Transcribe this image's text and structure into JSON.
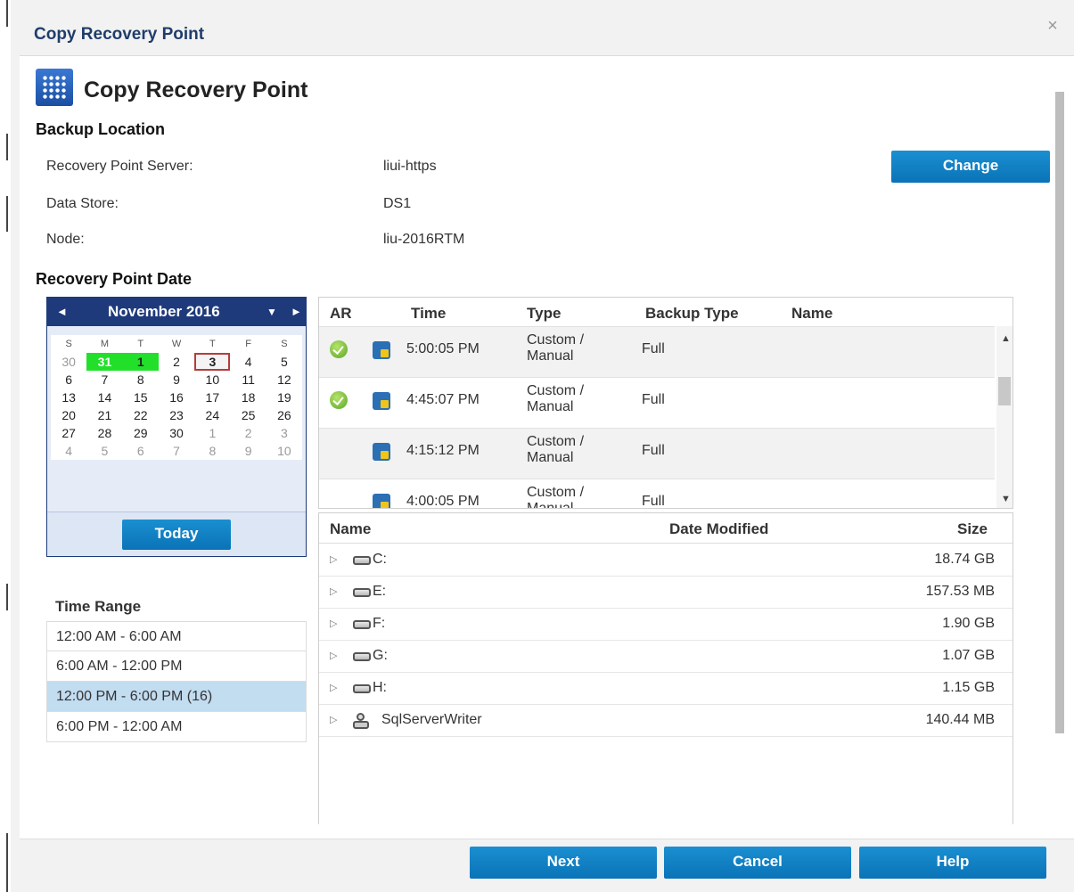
{
  "window": {
    "title": "Copy Recovery Point",
    "close_icon": "×"
  },
  "header": {
    "icon": "grid-app-icon",
    "title": "Copy Recovery Point"
  },
  "backup_location": {
    "section_title": "Backup Location",
    "server_label": "Recovery Point Server:",
    "server_value": "liui-https",
    "store_label": "Data Store:",
    "store_value": "DS1",
    "node_label": "Node:",
    "node_value": "liu-2016RTM",
    "change_button": "Change"
  },
  "recovery_point_date": {
    "section_title": "Recovery Point Date"
  },
  "calendar": {
    "month": "November 2016",
    "prev_icon": "◄",
    "dropdown_icon": "▼",
    "next_icon": "►",
    "weekdays": [
      "S",
      "M",
      "T",
      "W",
      "T",
      "F",
      "S"
    ],
    "today_button": "Today",
    "days": [
      {
        "label": "30",
        "other": true,
        "hl": false,
        "today": false
      },
      {
        "label": "31",
        "other": true,
        "hl": true,
        "today": false
      },
      {
        "label": "1",
        "other": false,
        "hl": true,
        "today": false
      },
      {
        "label": "2",
        "other": false,
        "hl": false,
        "today": false
      },
      {
        "label": "3",
        "other": false,
        "hl": false,
        "today": true
      },
      {
        "label": "4",
        "other": false,
        "hl": false,
        "today": false
      },
      {
        "label": "5",
        "other": false,
        "hl": false,
        "today": false
      },
      {
        "label": "6",
        "other": false,
        "hl": false,
        "today": false
      },
      {
        "label": "7",
        "other": false,
        "hl": false,
        "today": false
      },
      {
        "label": "8",
        "other": false,
        "hl": false,
        "today": false
      },
      {
        "label": "9",
        "other": false,
        "hl": false,
        "today": false
      },
      {
        "label": "10",
        "other": false,
        "hl": false,
        "today": false
      },
      {
        "label": "11",
        "other": false,
        "hl": false,
        "today": false
      },
      {
        "label": "12",
        "other": false,
        "hl": false,
        "today": false
      },
      {
        "label": "13",
        "other": false,
        "hl": false,
        "today": false
      },
      {
        "label": "14",
        "other": false,
        "hl": false,
        "today": false
      },
      {
        "label": "15",
        "other": false,
        "hl": false,
        "today": false
      },
      {
        "label": "16",
        "other": false,
        "hl": false,
        "today": false
      },
      {
        "label": "17",
        "other": false,
        "hl": false,
        "today": false
      },
      {
        "label": "18",
        "other": false,
        "hl": false,
        "today": false
      },
      {
        "label": "19",
        "other": false,
        "hl": false,
        "today": false
      },
      {
        "label": "20",
        "other": false,
        "hl": false,
        "today": false
      },
      {
        "label": "21",
        "other": false,
        "hl": false,
        "today": false
      },
      {
        "label": "22",
        "other": false,
        "hl": false,
        "today": false
      },
      {
        "label": "23",
        "other": false,
        "hl": false,
        "today": false
      },
      {
        "label": "24",
        "other": false,
        "hl": false,
        "today": false
      },
      {
        "label": "25",
        "other": false,
        "hl": false,
        "today": false
      },
      {
        "label": "26",
        "other": false,
        "hl": false,
        "today": false
      },
      {
        "label": "27",
        "other": false,
        "hl": false,
        "today": false
      },
      {
        "label": "28",
        "other": false,
        "hl": false,
        "today": false
      },
      {
        "label": "29",
        "other": false,
        "hl": false,
        "today": false
      },
      {
        "label": "30",
        "other": false,
        "hl": false,
        "today": false
      },
      {
        "label": "1",
        "other": true,
        "hl": false,
        "today": false
      },
      {
        "label": "2",
        "other": true,
        "hl": false,
        "today": false
      },
      {
        "label": "3",
        "other": true,
        "hl": false,
        "today": false
      },
      {
        "label": "4",
        "other": true,
        "hl": false,
        "today": false
      },
      {
        "label": "5",
        "other": true,
        "hl": false,
        "today": false
      },
      {
        "label": "6",
        "other": true,
        "hl": false,
        "today": false
      },
      {
        "label": "7",
        "other": true,
        "hl": false,
        "today": false
      },
      {
        "label": "8",
        "other": true,
        "hl": false,
        "today": false
      },
      {
        "label": "9",
        "other": true,
        "hl": false,
        "today": false
      },
      {
        "label": "10",
        "other": true,
        "hl": false,
        "today": false
      }
    ]
  },
  "time_range": {
    "title": "Time Range",
    "items": [
      {
        "label": "12:00 AM - 6:00 AM",
        "selected": false
      },
      {
        "label": "6:00 AM - 12:00 PM",
        "selected": false
      },
      {
        "label": "12:00 PM - 6:00 PM  (16)",
        "selected": true
      },
      {
        "label": "6:00 PM - 12:00 AM",
        "selected": false
      }
    ]
  },
  "recovery_points": {
    "columns": {
      "ar": "AR",
      "time": "Time",
      "type": "Type",
      "backup_type": "Backup Type",
      "name": "Name"
    },
    "rows": [
      {
        "ar": true,
        "time": "5:00:05 PM",
        "type": "Custom / Manual",
        "backup_type": "Full",
        "name": ""
      },
      {
        "ar": true,
        "time": "4:45:07 PM",
        "type": "Custom / Manual",
        "backup_type": "Full",
        "name": ""
      },
      {
        "ar": false,
        "time": "4:15:12 PM",
        "type": "Custom / Manual",
        "backup_type": "Full",
        "name": ""
      },
      {
        "ar": false,
        "time": "4:00:05 PM",
        "type": "Custom / Manual",
        "backup_type": "Full",
        "name": ""
      }
    ]
  },
  "files": {
    "columns": {
      "name": "Name",
      "date_modified": "Date Modified",
      "size": "Size"
    },
    "rows": [
      {
        "name": "C:",
        "icon": "drive-icon",
        "size": "18.74 GB"
      },
      {
        "name": "E:",
        "icon": "drive-icon",
        "size": "157.53 MB"
      },
      {
        "name": "F:",
        "icon": "drive-icon",
        "size": "1.90 GB"
      },
      {
        "name": "G:",
        "icon": "drive-icon",
        "size": "1.07 GB"
      },
      {
        "name": "H:",
        "icon": "drive-icon",
        "size": "1.15 GB"
      },
      {
        "name": "SqlServerWriter",
        "icon": "writer-icon",
        "size": "140.44 MB"
      }
    ]
  },
  "footer": {
    "next": "Next",
    "cancel": "Cancel",
    "help": "Help"
  }
}
